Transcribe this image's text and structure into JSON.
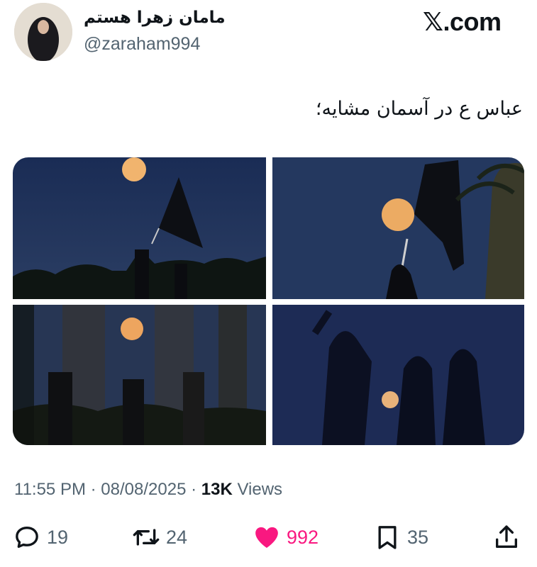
{
  "header": {
    "display_name": "مامان زهرا هستم",
    "handle": "@zaraham994",
    "brand_glyph": "𝕏",
    "brand_text": ".com"
  },
  "tweet": {
    "text": "عباس ع در آسمان مشایه؛"
  },
  "media": {
    "images": [
      {
        "name": "moon-flag-procession-photo"
      },
      {
        "name": "moon-black-flag-palms-photo"
      },
      {
        "name": "pilgrims-walking-moon-photo"
      },
      {
        "name": "silhouettes-moon-night-photo"
      }
    ]
  },
  "meta": {
    "time": "11:55 PM",
    "separator": "·",
    "date": "08/08/2025",
    "views_count": "13K",
    "views_label": "Views"
  },
  "actions": {
    "reply_count": "19",
    "retweet_count": "24",
    "like_count": "992",
    "bookmark_count": "35"
  },
  "colors": {
    "text_primary": "#0f1419",
    "text_secondary": "#536471",
    "like_pink": "#f91880",
    "night_sky": "#1e2f55",
    "moon": "#f0b26a"
  }
}
